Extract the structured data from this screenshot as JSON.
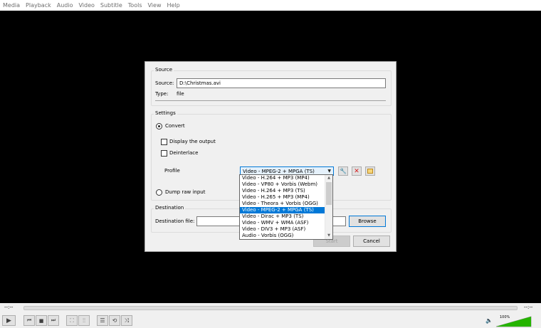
{
  "menu": [
    "Media",
    "Playback",
    "Audio",
    "Video",
    "Subtitle",
    "Tools",
    "View",
    "Help"
  ],
  "dialog": {
    "source_group": "Source",
    "source_label": "Source:",
    "source_value": "D:\\Christmas.avi",
    "type_label": "Type:",
    "type_value": "file",
    "settings_group": "Settings",
    "convert_label": "Convert",
    "display_output_label": "Display the output",
    "deinterlace_label": "Deinterlace",
    "profile_label": "Profile",
    "profile_selected": "Video - MPEG-2 + MPGA (TS)",
    "dump_raw_label": "Dump raw input",
    "destination_group": "Destination",
    "destination_file_label": "Destination file:",
    "destination_value": "",
    "browse_label": "Browse",
    "start_label": "Start",
    "cancel_label": "Cancel"
  },
  "profile_options": [
    "Video - H.264 + MP3 (MP4)",
    "Video - VP80 + Vorbis (Webm)",
    "Video - H.264 + MP3 (TS)",
    "Video - H.265 + MP3 (MP4)",
    "Video - Theora + Vorbis (OGG)",
    "Video - MPEG-2 + MPGA (TS)",
    "Video - Dirac + MP3 (TS)",
    "Video - WMV + WMA (ASF)",
    "Video - DIV3 + MP3 (ASF)",
    "Audio - Vorbis (OGG)"
  ],
  "selected_option_index": 5,
  "controls": {
    "time_elapsed": "--:--",
    "time_total": "--:--",
    "volume": "100%",
    "volume_level": 1.0
  },
  "colors": {
    "selection": "#0078d7",
    "volume_green": "#25b400"
  }
}
